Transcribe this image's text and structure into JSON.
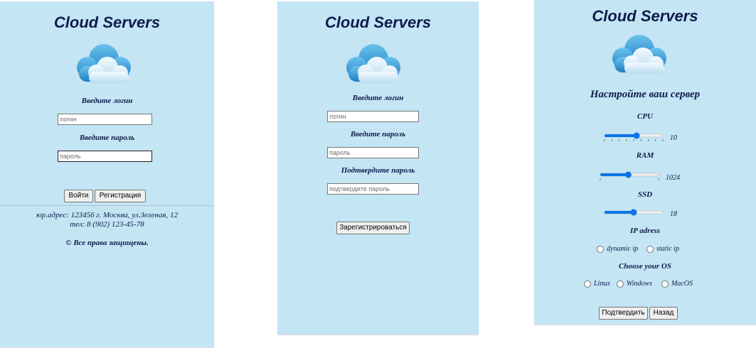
{
  "app_title": "Cloud Servers",
  "login": {
    "login_label": "Введите логин",
    "login_placeholder": "логин",
    "password_label": "Введите пароль",
    "password_placeholder": "пароль",
    "login_button": "Войти",
    "register_button": "Регистрация",
    "address": "юр.адрес: 123456 г. Москва, ул.Зеленая, 12",
    "phone": "тел: 8 (902) 123-45-78",
    "copyright": "© Все права защищены."
  },
  "register": {
    "login_label": "Введите логин",
    "login_placeholder": "логин",
    "password_label": "Введите пароль",
    "password_placeholder": "пароль",
    "confirm_label": "Подтвердите пароль",
    "confirm_placeholder": "подтвердите пароль",
    "submit_button": "Зарегистрироваться"
  },
  "config": {
    "heading": "Настройте ваш сервер",
    "cpu_label": "CPU",
    "cpu_value": "10",
    "cpu_fraction": 0.55,
    "ram_label": "RAM",
    "ram_value": "1024",
    "ram_fraction": 0.48,
    "ssd_label": "SSD",
    "ssd_value": "18",
    "ssd_fraction": 0.5,
    "ip_label": "IP adress",
    "ip_options": [
      "dynamic ip",
      "static ip"
    ],
    "os_label": "Choose your OS",
    "os_options": [
      "Linux",
      "Windows",
      "MacOS"
    ],
    "confirm_button": "Подтвердить",
    "back_button": "Назад"
  },
  "colors": {
    "panel_bg": "#c4e5f4",
    "text": "#0e1b4b",
    "slider_accent": "#0a75e8"
  }
}
